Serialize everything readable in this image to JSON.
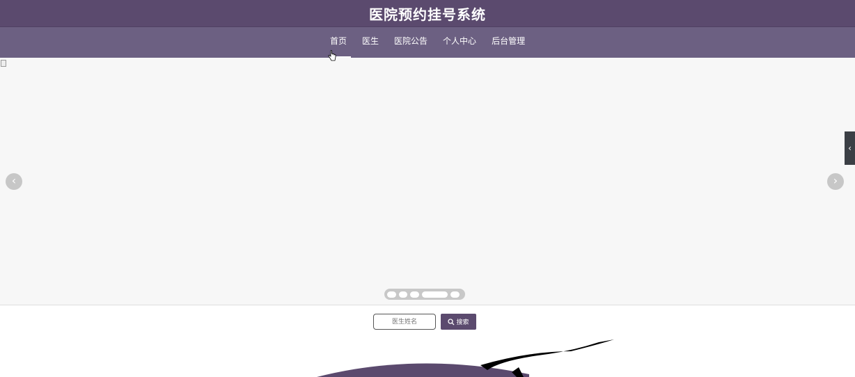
{
  "header": {
    "title": "医院预约挂号系统"
  },
  "nav": {
    "items": [
      {
        "label": "首页",
        "active": true
      },
      {
        "label": "医生"
      },
      {
        "label": "医院公告"
      },
      {
        "label": "个人中心"
      },
      {
        "label": "后台管理"
      }
    ]
  },
  "carousel": {
    "prev_icon": "chevron-left-icon",
    "next_icon": "chevron-right-icon",
    "dot_count": 5,
    "active_dot": 4
  },
  "search": {
    "placeholder": "医生姓名",
    "button_label": "搜索",
    "button_icon": "search-icon"
  },
  "colors": {
    "header_bg": "#5b4a6e",
    "nav_bg": "#6c6082",
    "accent": "#5b4a6e"
  }
}
